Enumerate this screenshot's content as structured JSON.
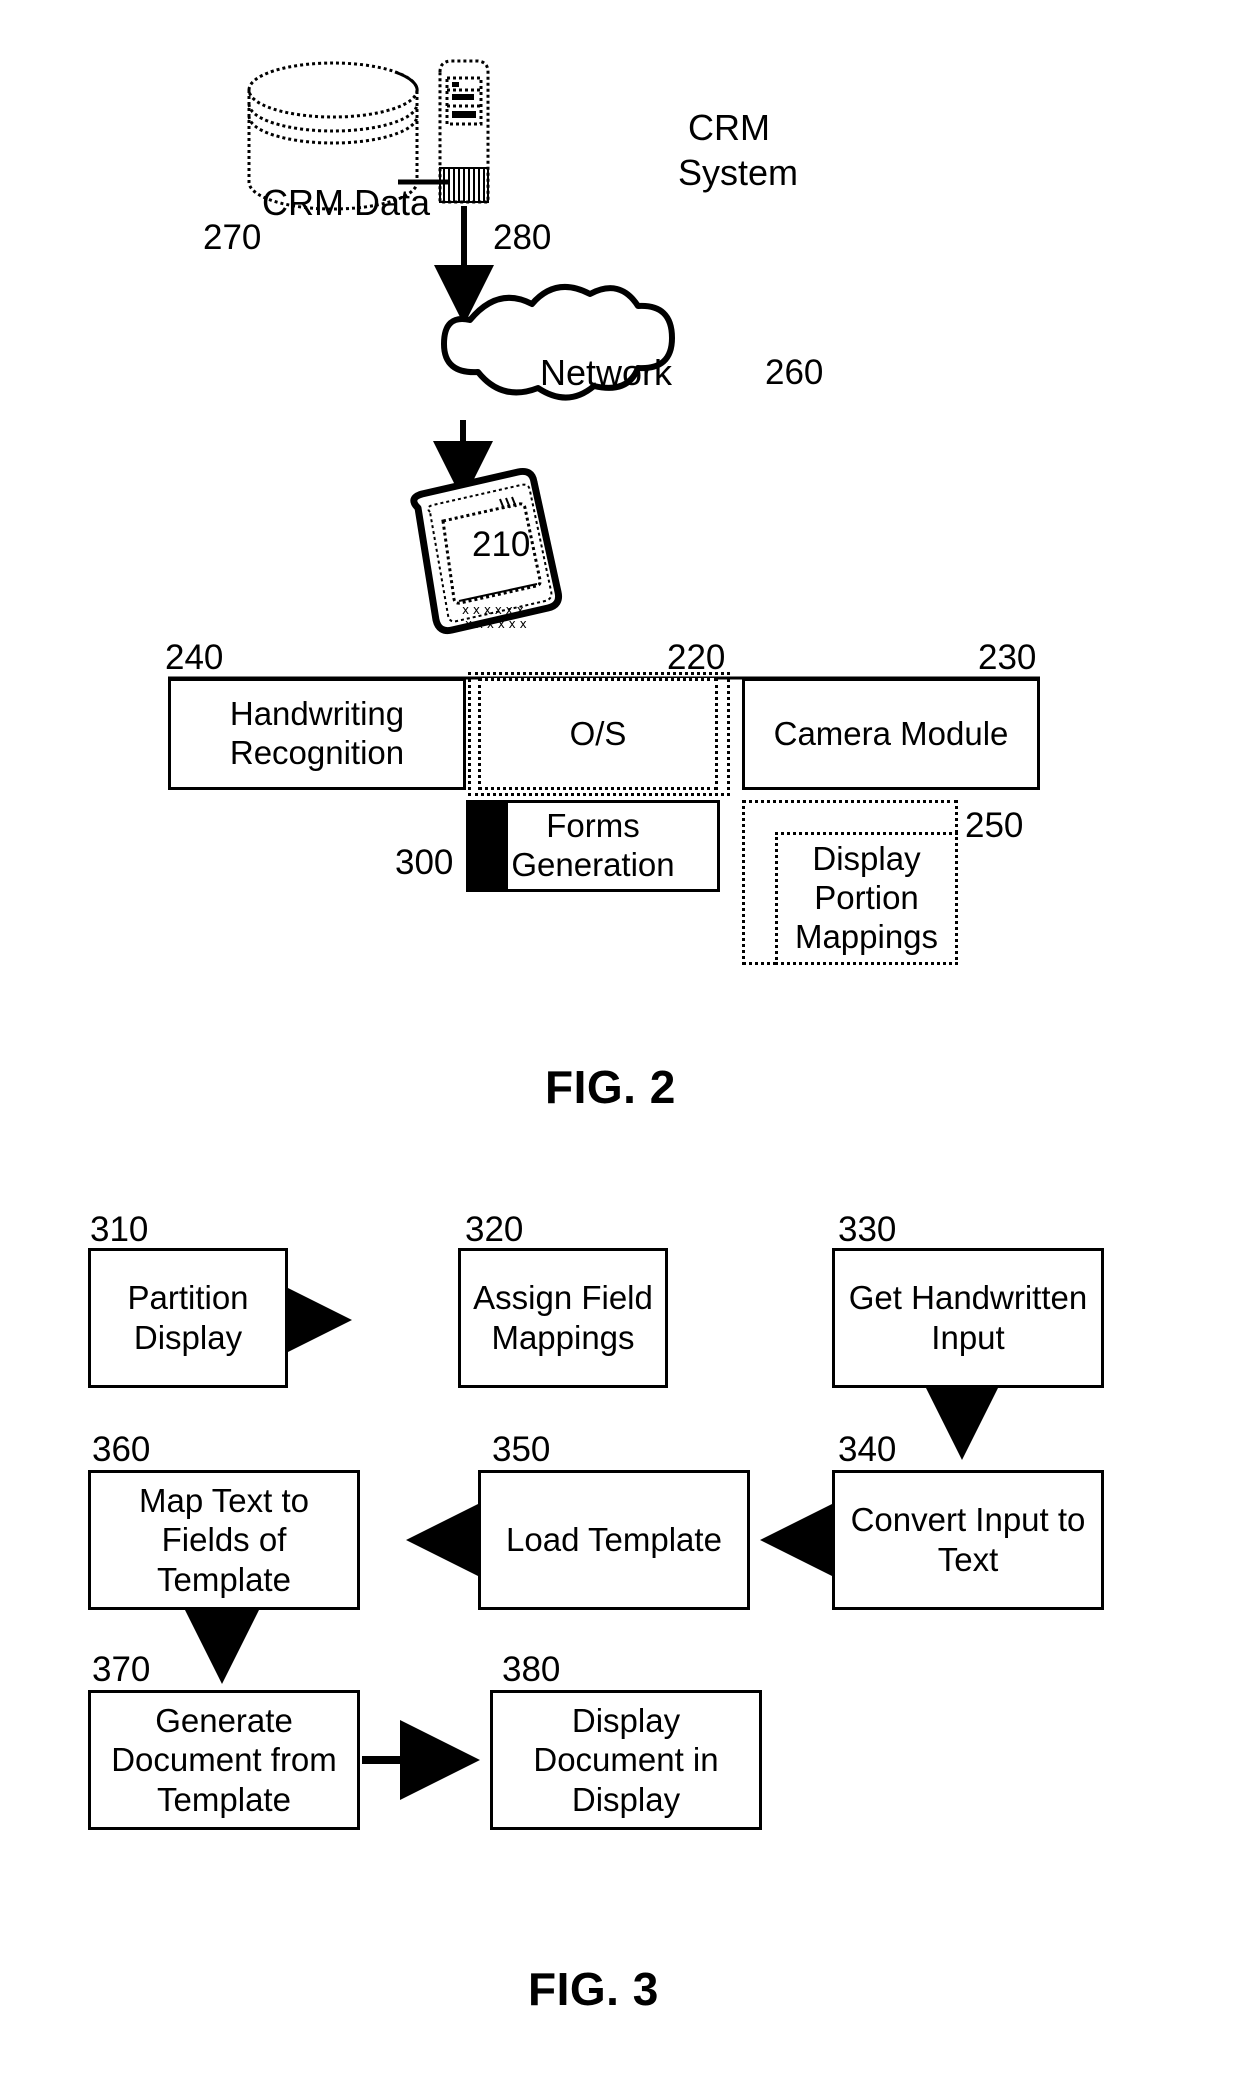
{
  "figure2": {
    "caption": "FIG. 2",
    "nodes": {
      "crm_data": {
        "label": "CRM Data",
        "ref": "270"
      },
      "crm_system": {
        "label_line1": "CRM",
        "label_line2": "System",
        "ref": "280"
      },
      "network": {
        "label": "Network",
        "ref": "260"
      },
      "device": {
        "ref": "210"
      },
      "handwriting": {
        "label_line1": "Handwriting",
        "label_line2": "Recognition",
        "ref": "240"
      },
      "os": {
        "label": "O/S",
        "ref": "220"
      },
      "camera": {
        "label": "Camera Module",
        "ref": "230"
      },
      "forms": {
        "label_line1": "Forms",
        "label_line2": "Generation",
        "ref": "300"
      },
      "mappings": {
        "label_line1": "Display",
        "label_line2": "Portion",
        "label_line3": "Mappings",
        "ref": "250"
      }
    }
  },
  "figure3": {
    "caption": "FIG. 3",
    "steps": [
      {
        "ref": "310",
        "lines": [
          "Partition",
          "Display"
        ]
      },
      {
        "ref": "320",
        "lines": [
          "Assign Field",
          "Mappings"
        ]
      },
      {
        "ref": "330",
        "lines": [
          "Get",
          "Handwritten",
          "Input"
        ]
      },
      {
        "ref": "340",
        "lines": [
          "Convert Input",
          "to Text"
        ]
      },
      {
        "ref": "350",
        "lines": [
          "Load Template"
        ]
      },
      {
        "ref": "360",
        "lines": [
          "Map Text to",
          "Fields of",
          "Template"
        ]
      },
      {
        "ref": "370",
        "lines": [
          "Generate",
          "Document from",
          "Template"
        ]
      },
      {
        "ref": "380",
        "lines": [
          "Display",
          "Document in",
          "Display"
        ]
      }
    ]
  },
  "colors": {
    "ink": "#000000",
    "paper": "#ffffff"
  }
}
